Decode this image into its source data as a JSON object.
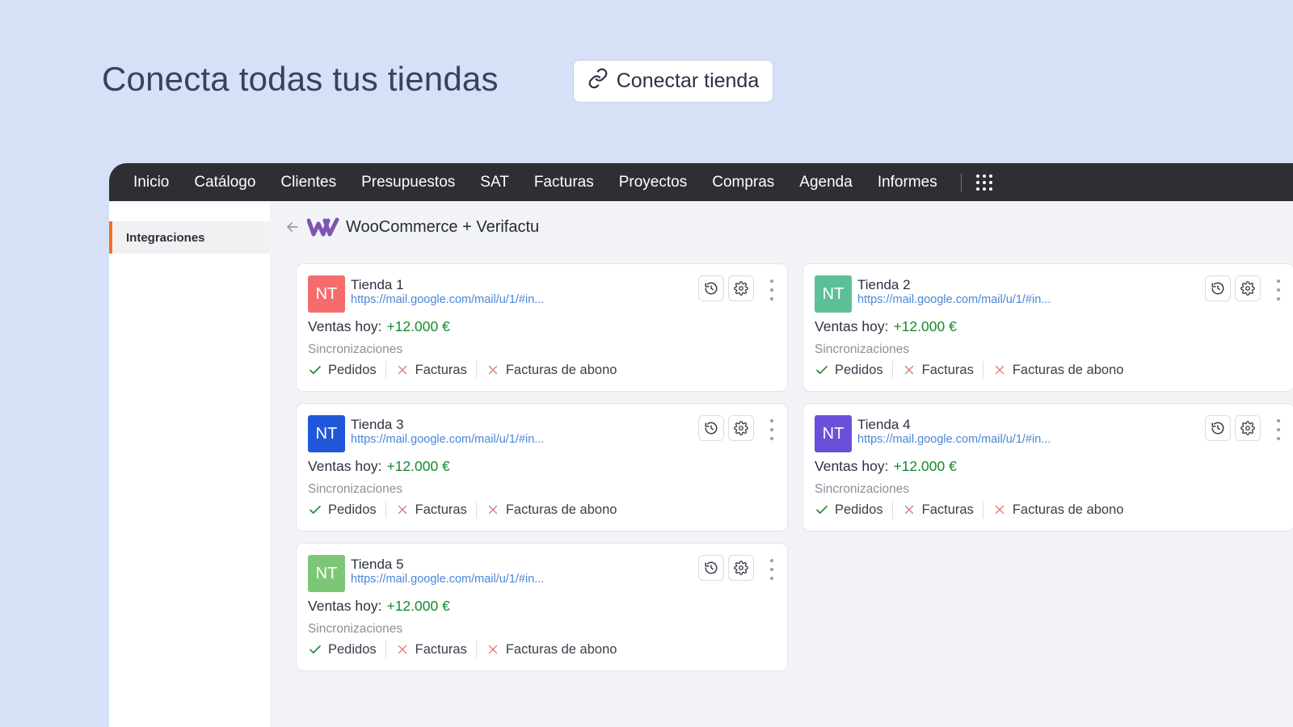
{
  "hero": {
    "title": "Conecta todas tus tiendas",
    "connect_button": "Conectar tienda"
  },
  "nav": {
    "items": [
      "Inicio",
      "Catálogo",
      "Clientes",
      "Presupuestos",
      "SAT",
      "Facturas",
      "Proyectos",
      "Compras",
      "Agenda",
      "Informes"
    ],
    "apps_icon": "grid-icon"
  },
  "sidebar": {
    "items": [
      {
        "label": "Integraciones",
        "active": true
      }
    ]
  },
  "page": {
    "title": "WooCommerce + Verifactu",
    "back_icon": "arrow-left-icon",
    "logo_icon": "woocommerce-logo"
  },
  "colors": {
    "accent": "#f07122",
    "sales_positive": "#138a2e",
    "link": "#4a86d8",
    "check": "#1f8a3a",
    "cross": "#e07a7a"
  },
  "stores": [
    {
      "initials": "NT",
      "color": "#f56c6c",
      "name": "Tienda 1",
      "url": "https://mail.google.com/mail/u/1/#in...",
      "sales_label": "Ventas hoy:",
      "sales_value": "+12.000 €",
      "sync_title": "Sincronizaciones",
      "syncs": [
        {
          "label": "Pedidos",
          "enabled": true
        },
        {
          "label": "Facturas",
          "enabled": false
        },
        {
          "label": "Facturas de abono",
          "enabled": false
        }
      ]
    },
    {
      "initials": "NT",
      "color": "#5cbf98",
      "name": "Tienda 2",
      "url": "https://mail.google.com/mail/u/1/#in...",
      "sales_label": "Ventas hoy:",
      "sales_value": "+12.000 €",
      "sync_title": "Sincronizaciones",
      "syncs": [
        {
          "label": "Pedidos",
          "enabled": true
        },
        {
          "label": "Facturas",
          "enabled": false
        },
        {
          "label": "Facturas de abono",
          "enabled": false
        }
      ]
    },
    {
      "initials": "NT",
      "color": "#2057d9",
      "name": "Tienda 3",
      "url": "https://mail.google.com/mail/u/1/#in...",
      "sales_label": "Ventas hoy:",
      "sales_value": "+12.000 €",
      "sync_title": "Sincronizaciones",
      "syncs": [
        {
          "label": "Pedidos",
          "enabled": true
        },
        {
          "label": "Facturas",
          "enabled": false
        },
        {
          "label": "Facturas de abono",
          "enabled": false
        }
      ]
    },
    {
      "initials": "NT",
      "color": "#6a4fdb",
      "name": "Tienda 4",
      "url": "https://mail.google.com/mail/u/1/#in...",
      "sales_label": "Ventas hoy:",
      "sales_value": "+12.000 €",
      "sync_title": "Sincronizaciones",
      "syncs": [
        {
          "label": "Pedidos",
          "enabled": true
        },
        {
          "label": "Facturas",
          "enabled": false
        },
        {
          "label": "Facturas de abono",
          "enabled": false
        }
      ]
    },
    {
      "initials": "NT",
      "color": "#7cc775",
      "name": "Tienda 5",
      "url": "https://mail.google.com/mail/u/1/#in...",
      "sales_label": "Ventas hoy:",
      "sales_value": "+12.000 €",
      "sync_title": "Sincronizaciones",
      "syncs": [
        {
          "label": "Pedidos",
          "enabled": true
        },
        {
          "label": "Facturas",
          "enabled": false
        },
        {
          "label": "Facturas de abono",
          "enabled": false
        }
      ]
    }
  ]
}
